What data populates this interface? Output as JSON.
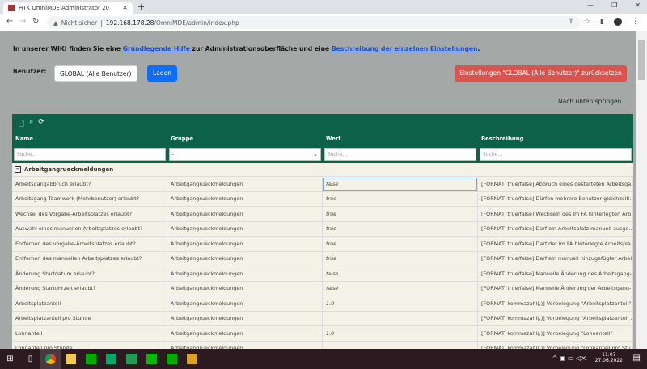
{
  "browser": {
    "tab_title": "HTK OmniMDE Administrator 20",
    "security": "Nicht sicher",
    "url_host": "192.168.178.28",
    "url_path": "/OmniMDE/admin/index.php"
  },
  "info": {
    "prefix": "In unserer WIKI finden Sie eine ",
    "link1": "Grundlegende Hilfe",
    "middle": " zur Administrationsoberfläche und eine ",
    "link2": "Beschreibung der einzelnen Einstellungen",
    "suffix": "."
  },
  "user": {
    "label": "Benutzer:",
    "value": "GLOBAL (Alle Benutzer)",
    "load": "Laden",
    "reset": "Einstellungen \"GLOBAL (Alle Benutzer)\" zurücksetzen"
  },
  "jump": "Nach unten springen",
  "grid": {
    "columns": [
      "Name",
      "Gruppe",
      "Wert",
      "Beschreibung"
    ],
    "filters": {
      "name": "Suche...",
      "gruppe": "-",
      "wert": "Suche...",
      "beschreibung": "Suche..."
    },
    "group": "Arbeitgangrueckmeldungen",
    "rows": [
      {
        "name": "Arbeitsgangabbruch erlaubt?",
        "gruppe": "Arbeitgangrueckmeldungen",
        "wert": "false",
        "beschreibung": "[FORMAT: true/false] Abbruch eines gestarteten Arbeitsga..."
      },
      {
        "name": "Arbeitsgang Teamwork (Mehrbenutzer) erlaubt?",
        "gruppe": "Arbeitgangrueckmeldungen",
        "wert": "true",
        "beschreibung": "[FORMAT: true/false] Dürfen mehrere Benutzer gleichzeiti..."
      },
      {
        "name": "Wechsel des Vorgabe-Arbeitsplatzes erlaubt?",
        "gruppe": "Arbeitgangrueckmeldungen",
        "wert": "true",
        "beschreibung": "[FORMAT: true/false] Wechseln des im FA hinterlegten Arb..."
      },
      {
        "name": "Auswahl eines manuellen Arbeitsplatzes erlaubt?",
        "gruppe": "Arbeitgangrueckmeldungen",
        "wert": "true",
        "beschreibung": "[FORMAT: true/false] Darf ein Arbeitsplatz manuell ausge..."
      },
      {
        "name": "Entfernen des vorgabe-Arbeitsplatzes erlaubt?",
        "gruppe": "Arbeitgangrueckmeldungen",
        "wert": "true",
        "beschreibung": "[FORMAT: true/false] Darf der im FA hinterlegte Arbeitspla..."
      },
      {
        "name": "Entfernen des manuellen Arbeitsplatzes erlaubt?",
        "gruppe": "Arbeitgangrueckmeldungen",
        "wert": "true",
        "beschreibung": "[FORMAT: true/false] Darf ein manuell hinzugefügter Arbei..."
      },
      {
        "name": "Änderung Startdatum erlaubt?",
        "gruppe": "Arbeitgangrueckmeldungen",
        "wert": "false",
        "beschreibung": "[FORMAT: true/false] Manuelle Änderung des Arbeitsgang-..."
      },
      {
        "name": "Änderung Startuhrzeit erlaubt?",
        "gruppe": "Arbeitgangrueckmeldungen",
        "wert": "false",
        "beschreibung": "[FORMAT: true/false] Manuelle Änderung der Arbeitsgang-..."
      },
      {
        "name": "Arbeitsplatzanteil",
        "gruppe": "Arbeitgangrueckmeldungen",
        "wert": "1.0",
        "beschreibung": "[FORMAT: kommazahl(,)] Vorbelegung \"Arbeitsplatzanteil\""
      },
      {
        "name": "Arbeitsplatzanteil pro Stunde",
        "gruppe": "Arbeitgangrueckmeldungen",
        "wert": "",
        "beschreibung": "[FORMAT: kommazahl(,)] Vorbelegung \"Arbeitsplatzanteil ..."
      },
      {
        "name": "Lohnanteil",
        "gruppe": "Arbeitgangrueckmeldungen",
        "wert": "1.0",
        "beschreibung": "[FORMAT: kommazahl(,)] Vorbelegung \"Lohnanteil\""
      },
      {
        "name": "Lohnanteil pro Stunde",
        "gruppe": "Arbeitgangrueckmeldungen",
        "wert": "",
        "beschreibung": "[FORMAT: kommazahl(,)] Vorbelegung \"Lohnanteil pro Stu..."
      }
    ]
  },
  "taskbar": {
    "time": "11:07",
    "date": "27.06.2022"
  }
}
